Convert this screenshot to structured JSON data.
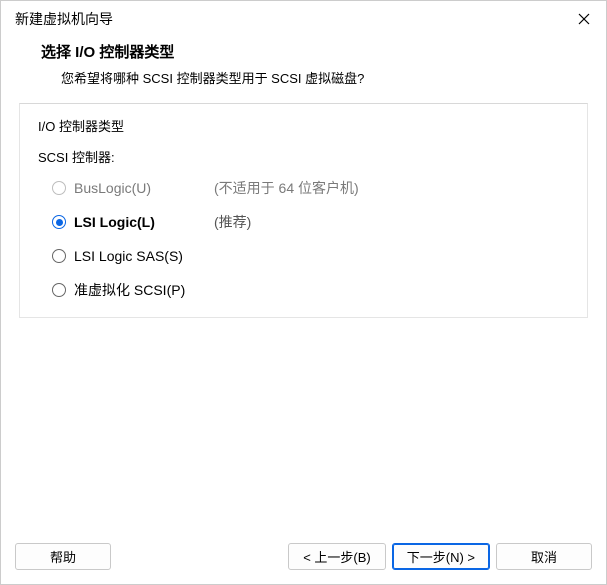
{
  "window": {
    "title": "新建虚拟机向导"
  },
  "header": {
    "title": "选择 I/O 控制器类型",
    "subtitle": "您希望将哪种 SCSI 控制器类型用于 SCSI 虚拟磁盘?"
  },
  "panel": {
    "title": "I/O 控制器类型",
    "group_label": "SCSI 控制器:",
    "options": [
      {
        "label": "BusLogic(U)",
        "note": "(不适用于 64 位客户机)",
        "disabled": true,
        "selected": false
      },
      {
        "label": "LSI Logic(L)",
        "note": "(推荐)",
        "disabled": false,
        "selected": true
      },
      {
        "label": "LSI Logic SAS(S)",
        "note": "",
        "disabled": false,
        "selected": false
      },
      {
        "label": "准虚拟化 SCSI(P)",
        "note": "",
        "disabled": false,
        "selected": false
      }
    ]
  },
  "footer": {
    "help": "帮助",
    "back": "< 上一步(B)",
    "next": "下一步(N) >",
    "cancel": "取消"
  }
}
